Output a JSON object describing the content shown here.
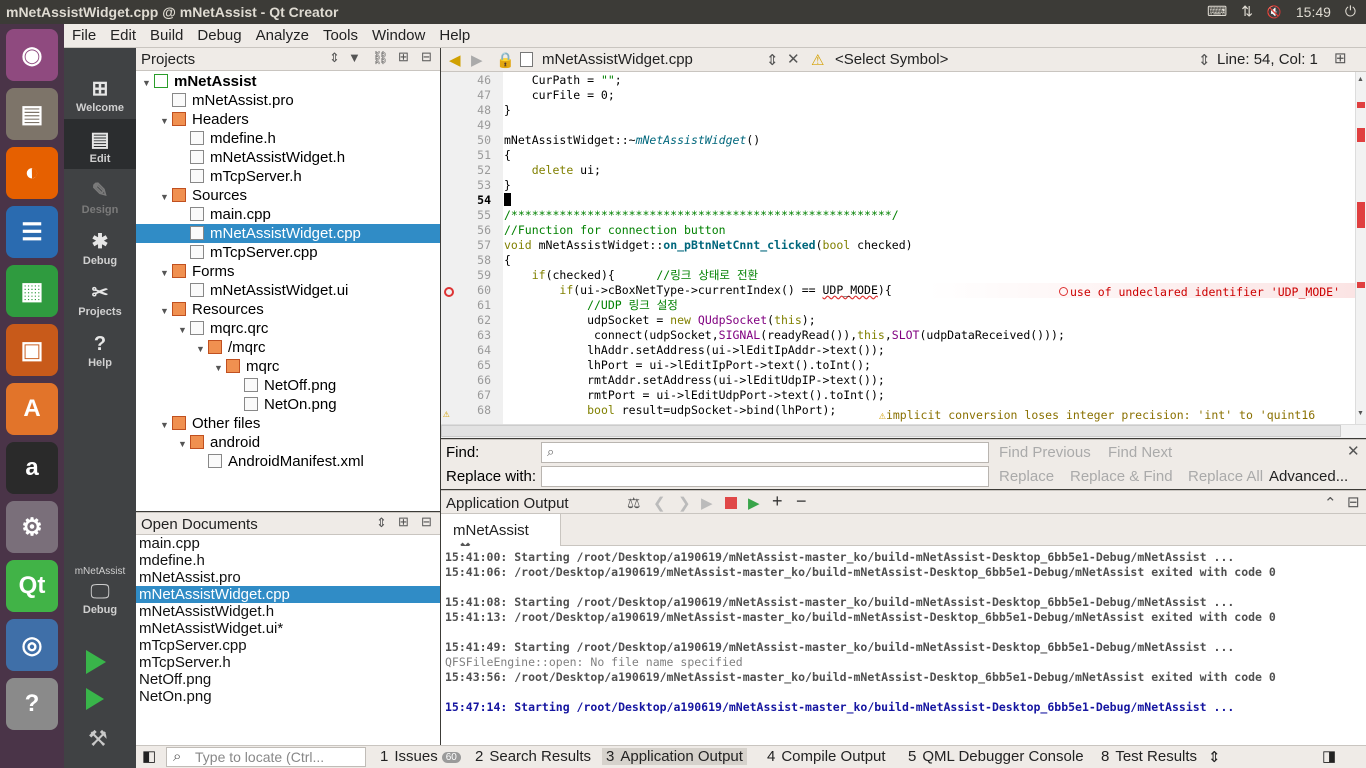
{
  "window": {
    "title": "mNetAssistWidget.cpp @ mNetAssist - Qt Creator"
  },
  "tray": {
    "keyboard": "⌨",
    "network": "⇅",
    "volume": "🔇",
    "time": "15:49"
  },
  "launcher": [
    {
      "name": "ubuntu-dash-icon",
      "glyph": "◉",
      "color": "#8f4a7f"
    },
    {
      "name": "files-icon",
      "glyph": "▤",
      "color": "#7d7469"
    },
    {
      "name": "firefox-icon",
      "glyph": "◐",
      "color": "#e66000"
    },
    {
      "name": "writer-icon",
      "glyph": "☰",
      "color": "#2a6bb0"
    },
    {
      "name": "calc-icon",
      "glyph": "▦",
      "color": "#2f9b3f"
    },
    {
      "name": "impress-icon",
      "glyph": "▣",
      "color": "#c85a1a"
    },
    {
      "name": "software-center-icon",
      "glyph": "A",
      "color": "#e2742a"
    },
    {
      "name": "amazon-icon",
      "glyph": "a",
      "color": "#2a2a2a"
    },
    {
      "name": "system-settings-icon",
      "glyph": "⚙",
      "color": "#7a6f7a"
    },
    {
      "name": "qt-creator-icon",
      "glyph": "Qt",
      "color": "#41b347"
    },
    {
      "name": "remote-desktop-icon",
      "glyph": "◎",
      "color": "#3f6fa8"
    },
    {
      "name": "help-icon",
      "glyph": "?",
      "color": "#8a8a8a"
    }
  ],
  "menu": [
    "File",
    "Edit",
    "Build",
    "Debug",
    "Analyze",
    "Tools",
    "Window",
    "Help"
  ],
  "modes": [
    {
      "label": "Welcome",
      "glyph": "⊞"
    },
    {
      "label": "Edit",
      "glyph": "▤"
    },
    {
      "label": "Design",
      "glyph": "✎"
    },
    {
      "label": "Debug",
      "glyph": "✱"
    },
    {
      "label": "Projects",
      "glyph": "✂"
    },
    {
      "label": "Help",
      "glyph": "?"
    }
  ],
  "kit": {
    "project": "mNetAssist",
    "label": "Debug"
  },
  "projects": {
    "header": "Projects",
    "tree": [
      {
        "label": "mNetAssist",
        "level": 0,
        "arrow": "▼",
        "icon": "proj",
        "bold": true
      },
      {
        "label": "mNetAssist.pro",
        "level": 1,
        "arrow": "",
        "icon": "file"
      },
      {
        "label": "Headers",
        "level": 1,
        "arrow": "▼",
        "icon": "folder"
      },
      {
        "label": "mdefine.h",
        "level": 2,
        "arrow": "",
        "icon": "file"
      },
      {
        "label": "mNetAssistWidget.h",
        "level": 2,
        "arrow": "",
        "icon": "file"
      },
      {
        "label": "mTcpServer.h",
        "level": 2,
        "arrow": "",
        "icon": "file"
      },
      {
        "label": "Sources",
        "level": 1,
        "arrow": "▼",
        "icon": "folder"
      },
      {
        "label": "main.cpp",
        "level": 2,
        "arrow": "",
        "icon": "file"
      },
      {
        "label": "mNetAssistWidget.cpp",
        "level": 2,
        "arrow": "",
        "icon": "file",
        "selected": true
      },
      {
        "label": "mTcpServer.cpp",
        "level": 2,
        "arrow": "",
        "icon": "file"
      },
      {
        "label": "Forms",
        "level": 1,
        "arrow": "▼",
        "icon": "folder"
      },
      {
        "label": "mNetAssistWidget.ui",
        "level": 2,
        "arrow": "",
        "icon": "file"
      },
      {
        "label": "Resources",
        "level": 1,
        "arrow": "▼",
        "icon": "folder"
      },
      {
        "label": "mqrc.qrc",
        "level": 2,
        "arrow": "▼",
        "icon": "file"
      },
      {
        "label": "/mqrc",
        "level": 3,
        "arrow": "▼",
        "icon": "folder"
      },
      {
        "label": "mqrc",
        "level": 4,
        "arrow": "▼",
        "icon": "folder"
      },
      {
        "label": "NetOff.png",
        "level": 5,
        "arrow": "",
        "icon": "file"
      },
      {
        "label": "NetOn.png",
        "level": 5,
        "arrow": "",
        "icon": "file"
      },
      {
        "label": "Other files",
        "level": 1,
        "arrow": "▼",
        "icon": "folder"
      },
      {
        "label": "android",
        "level": 2,
        "arrow": "▼",
        "icon": "folder"
      },
      {
        "label": "AndroidManifest.xml",
        "level": 3,
        "arrow": "",
        "icon": "file"
      }
    ]
  },
  "open_documents": {
    "header": "Open Documents",
    "items": [
      "main.cpp",
      "mdefine.h",
      "mNetAssist.pro",
      "mNetAssistWidget.cpp",
      "mNetAssistWidget.h",
      "mNetAssistWidget.ui*",
      "mTcpServer.cpp",
      "mTcpServer.h",
      "NetOff.png",
      "NetOn.png"
    ],
    "selected": "mNetAssistWidget.cpp"
  },
  "editor": {
    "file": "mNetAssistWidget.cpp",
    "symbol": "<Select Symbol>",
    "position": "Line: 54, Col: 1",
    "lines": [
      {
        "n": "46",
        "code": "    CurPath = \"\";"
      },
      {
        "n": "47",
        "code": "    curFile = 0;"
      },
      {
        "n": "48",
        "code": "}"
      },
      {
        "n": "49",
        "code": ""
      },
      {
        "n": "50",
        "code": "mNetAssistWidget::~mNetAssistWidget()"
      },
      {
        "n": "51",
        "code": "{"
      },
      {
        "n": "52",
        "code": "    delete ui;"
      },
      {
        "n": "53",
        "code": "}"
      },
      {
        "n": "54",
        "code": ""
      },
      {
        "n": "55",
        "code": "/*******************************************************/"
      },
      {
        "n": "56",
        "code": "//Function for connection button"
      },
      {
        "n": "57",
        "code": "void mNetAssistWidget::on_pBtnNetCnnt_clicked(bool checked)"
      },
      {
        "n": "58",
        "code": "{"
      },
      {
        "n": "59",
        "code": "    if(checked){      //링크 상태로 전환"
      },
      {
        "n": "60",
        "code": "        if(ui->cBoxNetType->currentIndex() == UDP_MODE){"
      },
      {
        "n": "61",
        "code": "            //UDP 링크 설정"
      },
      {
        "n": "62",
        "code": "            udpSocket = new QUdpSocket(this);"
      },
      {
        "n": "63",
        "code": "             connect(udpSocket,SIGNAL(readyRead()),this,SLOT(udpDataReceived()));"
      },
      {
        "n": "64",
        "code": "            lhAddr.setAddress(ui->lEditIpAddr->text());"
      },
      {
        "n": "65",
        "code": "            lhPort = ui->lEditIpPort->text().toInt();"
      },
      {
        "n": "66",
        "code": "            rmtAddr.setAddress(ui->lEditUdpIP->text());"
      },
      {
        "n": "67",
        "code": "            rmtPort = ui->lEditUdpPort->text().toInt();"
      },
      {
        "n": "68",
        "code": "            bool result=udpSocket->bind(lhPort);"
      }
    ],
    "error_annotation": "use of undeclared identifier 'UDP_MODE'",
    "warning_annotation": "implicit conversion loses integer precision: 'int' to 'quint16"
  },
  "find": {
    "find_label": "Find:",
    "replace_label": "Replace with:",
    "find_previous": "Find Previous",
    "find_next": "Find Next",
    "replace": "Replace",
    "replace_find": "Replace & Find",
    "replace_all": "Replace All",
    "advanced": "Advanced..."
  },
  "app_output": {
    "header": "Application Output",
    "tab": "mNetAssist",
    "lines": [
      {
        "text": "15:41:00: Starting /root/Desktop/a190619/mNetAssist-master_ko/build-mNetAssist-Desktop_6bb5e1-Debug/mNetAssist ...",
        "style": "bold"
      },
      {
        "text": "15:41:06: /root/Desktop/a190619/mNetAssist-master_ko/build-mNetAssist-Desktop_6bb5e1-Debug/mNetAssist exited with code 0",
        "style": "bold"
      },
      {
        "text": "",
        "style": "plain"
      },
      {
        "text": "15:41:08: Starting /root/Desktop/a190619/mNetAssist-master_ko/build-mNetAssist-Desktop_6bb5e1-Debug/mNetAssist ...",
        "style": "bold"
      },
      {
        "text": "15:41:13: /root/Desktop/a190619/mNetAssist-master_ko/build-mNetAssist-Desktop_6bb5e1-Debug/mNetAssist exited with code 0",
        "style": "bold"
      },
      {
        "text": "",
        "style": "plain"
      },
      {
        "text": "15:41:49: Starting /root/Desktop/a190619/mNetAssist-master_ko/build-mNetAssist-Desktop_6bb5e1-Debug/mNetAssist ...",
        "style": "bold"
      },
      {
        "text": "QFSFileEngine::open: No file name specified",
        "style": "plain"
      },
      {
        "text": "15:43:56: /root/Desktop/a190619/mNetAssist-master_ko/build-mNetAssist-Desktop_6bb5e1-Debug/mNetAssist exited with code 0",
        "style": "bold"
      },
      {
        "text": "",
        "style": "plain"
      },
      {
        "text": "15:47:14: Starting /root/Desktop/a190619/mNetAssist-master_ko/build-mNetAssist-Desktop_6bb5e1-Debug/mNetAssist ...",
        "style": "blue"
      }
    ]
  },
  "status": {
    "locator_placeholder": "Type to locate (Ctrl...",
    "tabs": [
      {
        "num": "1",
        "label": "Issues",
        "badge": "60"
      },
      {
        "num": "2",
        "label": "Search Results",
        "badge": ""
      },
      {
        "num": "3",
        "label": "Application Output",
        "badge": ""
      },
      {
        "num": "4",
        "label": "Compile Output",
        "badge": ""
      },
      {
        "num": "5",
        "label": "QML Debugger Console",
        "badge": ""
      },
      {
        "num": "8",
        "label": "Test Results",
        "badge": ""
      }
    ]
  }
}
